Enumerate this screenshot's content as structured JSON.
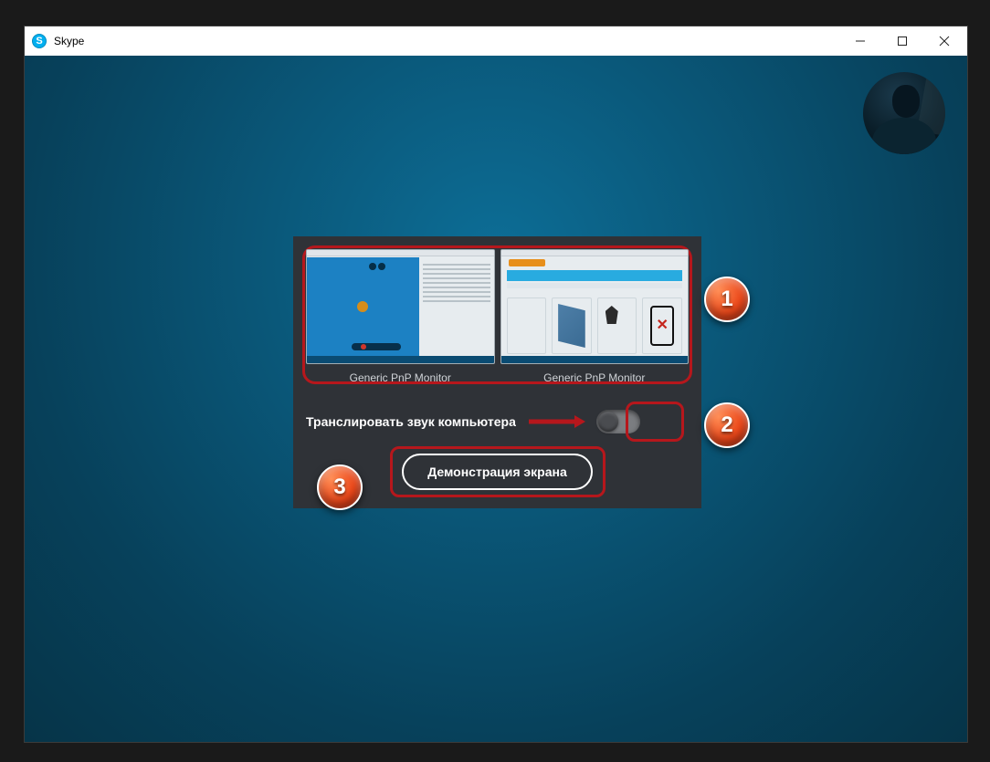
{
  "window": {
    "title": "Skype"
  },
  "dialog": {
    "monitors": [
      {
        "label": "Generic PnP Monitor"
      },
      {
        "label": "Generic PnP Monitor"
      }
    ],
    "audio_label": "Транслировать звук компьютера",
    "share_button": "Демонстрация экрана"
  },
  "callouts": {
    "1": "1",
    "2": "2",
    "3": "3"
  }
}
